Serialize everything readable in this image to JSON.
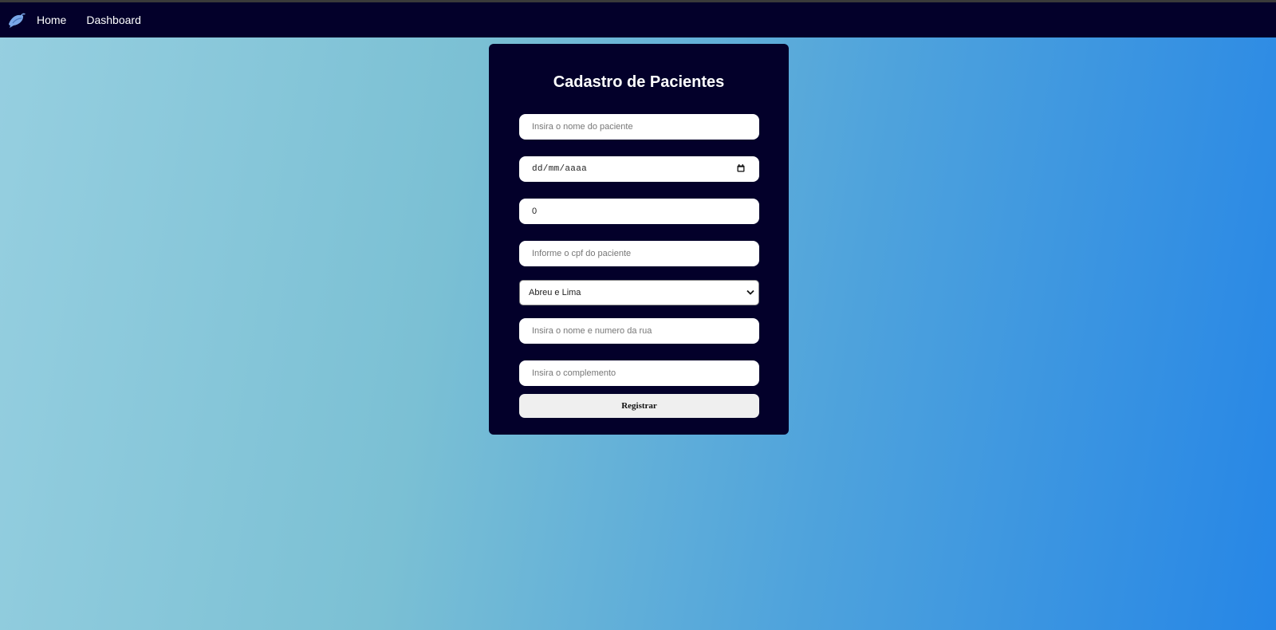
{
  "nav": {
    "logo_icon": "bird-icon",
    "home_label": "Home",
    "dashboard_label": "Dashboard"
  },
  "form": {
    "title": "Cadastro de Pacientes",
    "name_placeholder": "Insira o nome do paciente",
    "date_placeholder": "dd/mm/aaaa",
    "number_value": "0",
    "cpf_placeholder": "Informe o cpf do paciente",
    "city_selected": "Abreu e Lima",
    "street_placeholder": "Insira o nome e numero da rua",
    "complement_placeholder": "Insira o complemento",
    "submit_label": "Registrar"
  },
  "colors": {
    "navbar": "#03002a",
    "card": "#03002a",
    "gradient_start": "#96cfe0",
    "gradient_end": "#2686e6"
  }
}
